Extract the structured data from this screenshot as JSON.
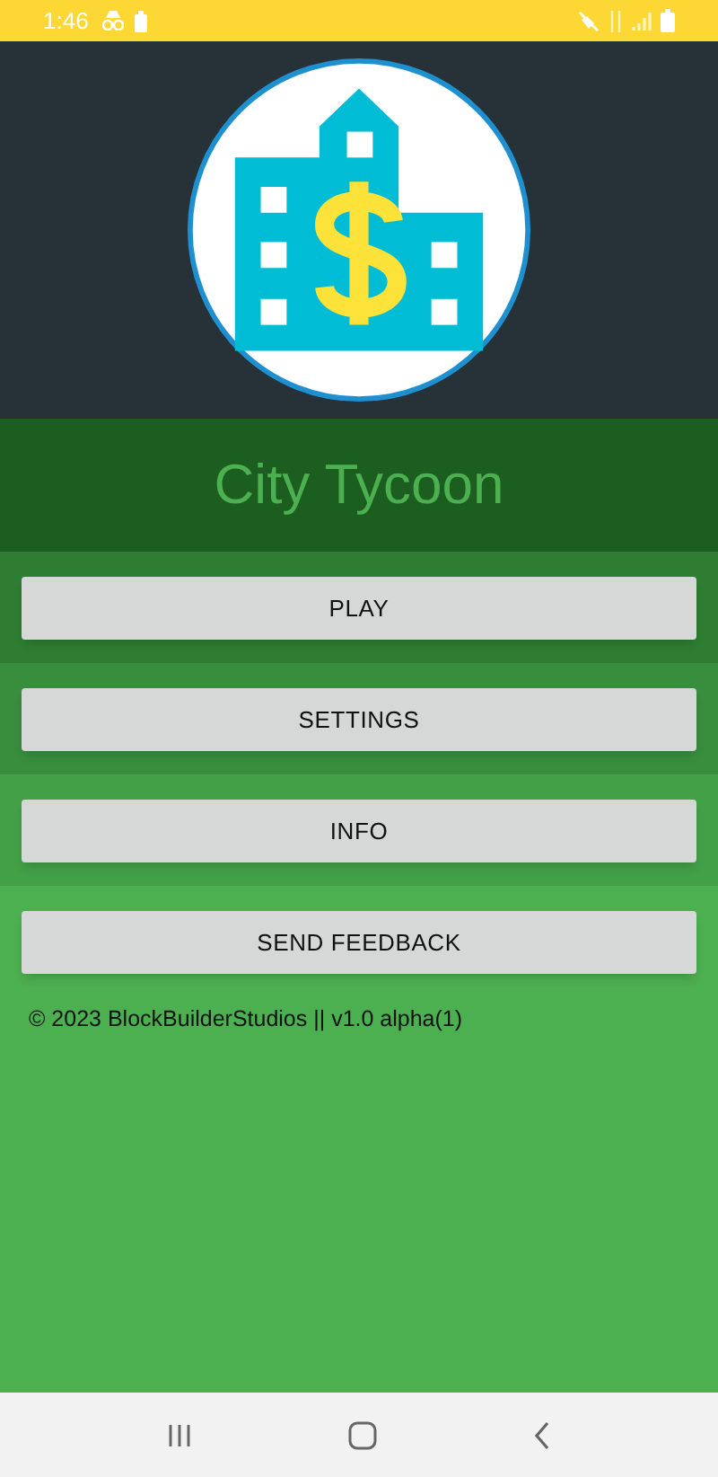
{
  "status_bar": {
    "time": "1:46"
  },
  "app": {
    "title": "City Tycoon"
  },
  "buttons": [
    {
      "label": "PLAY"
    },
    {
      "label": "SETTINGS"
    },
    {
      "label": "INFO"
    },
    {
      "label": "SEND FEEDBACK"
    }
  ],
  "footer": {
    "text": "© 2023 BlockBuilderStudios || v1.0 alpha(1)"
  }
}
